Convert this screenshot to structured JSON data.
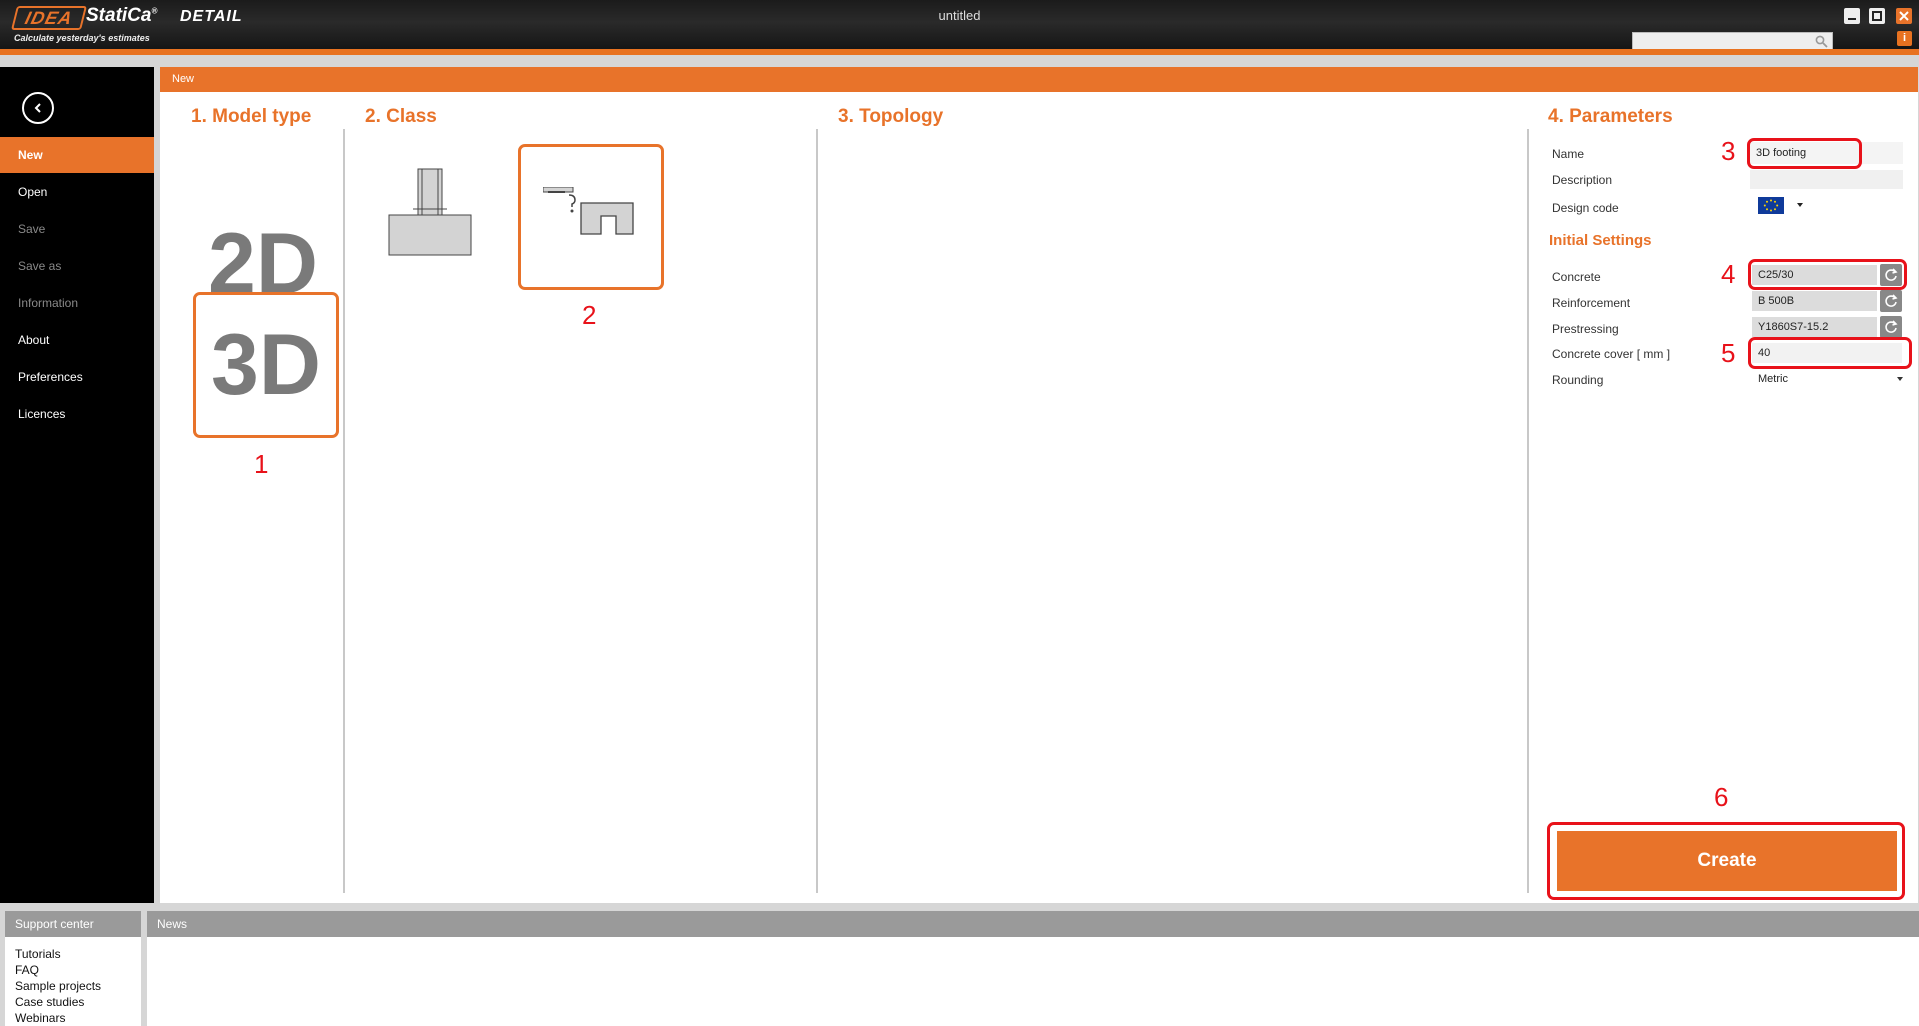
{
  "app": {
    "logo_brand": "IDEA",
    "logo_name": "StatiCa",
    "logo_mark": "®",
    "module": "DETAIL",
    "tagline": "Calculate yesterday's estimates",
    "document_title": "untitled",
    "info_badge": "i"
  },
  "sidebar": {
    "items": [
      {
        "label": "New",
        "state": "active"
      },
      {
        "label": "Open",
        "state": "normal"
      },
      {
        "label": "Save",
        "state": "disabled"
      },
      {
        "label": "Save as",
        "state": "disabled"
      },
      {
        "label": "Information",
        "state": "disabled"
      },
      {
        "label": "About",
        "state": "normal"
      },
      {
        "label": "Preferences",
        "state": "normal"
      },
      {
        "label": "Licences",
        "state": "normal"
      }
    ]
  },
  "main": {
    "header": "New",
    "sections": {
      "model_type": "1. Model type",
      "class": "2. Class",
      "topology": "3. Topology",
      "parameters": "4. Parameters"
    },
    "model_types": {
      "option_2d": "2D",
      "option_3d": "3D"
    },
    "markers": {
      "m1": "1",
      "m2": "2",
      "m3": "3",
      "m4": "4",
      "m5": "5",
      "m6": "6"
    },
    "parameters": {
      "name_label": "Name",
      "name_value": "3D footing",
      "description_label": "Description",
      "description_value": "",
      "design_code_label": "Design code",
      "initial_settings_title": "Initial Settings",
      "concrete_label": "Concrete",
      "concrete_value": "C25/30",
      "reinforcement_label": "Reinforcement",
      "reinforcement_value": "B 500B",
      "prestressing_label": "Prestressing",
      "prestressing_value": "Y1860S7-15.2",
      "cover_label": "Concrete cover  [ mm ]",
      "cover_value": "40",
      "rounding_label": "Rounding",
      "rounding_value": "Metric"
    },
    "create_label": "Create"
  },
  "bottom": {
    "support_title": "Support center",
    "support_links": [
      "Tutorials",
      "FAQ",
      "Sample projects",
      "Case studies",
      "Webinars"
    ],
    "news_title": "News"
  },
  "colors": {
    "accent": "#e8732a",
    "annotation": "#e8121a",
    "sidebar": "#000000"
  }
}
